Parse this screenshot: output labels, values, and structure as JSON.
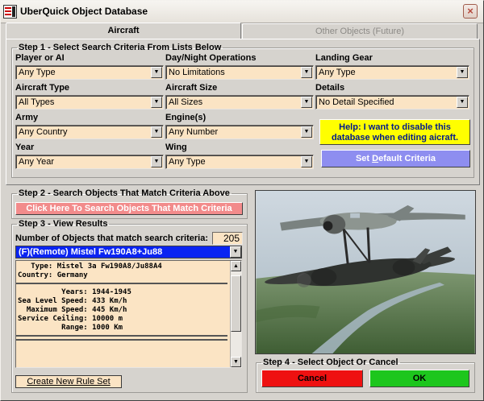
{
  "window": {
    "title": "UberQuick Object Database",
    "close_glyph": "×"
  },
  "tabs": [
    {
      "label": "Aircraft",
      "active": true
    },
    {
      "label": "Other Objects (Future)",
      "active": false
    }
  ],
  "step1": {
    "title": "Step 1 - Select Search Criteria From Lists Below",
    "fields": {
      "player": {
        "label": "Player or AI",
        "value": "Any Type"
      },
      "aircraft_type": {
        "label": "Aircraft Type",
        "value": "All Types"
      },
      "army": {
        "label": "Army",
        "value": "Any Country"
      },
      "year": {
        "label": "Year",
        "value": "Any Year"
      },
      "daynight": {
        "label": "Day/Night Operations",
        "value": "No Limitations"
      },
      "size": {
        "label": "Aircraft Size",
        "value": "All Sizes"
      },
      "engines": {
        "label": "Engine(s)",
        "value": "Any Number"
      },
      "wing": {
        "label": "Wing",
        "value": "Any Type"
      },
      "gear": {
        "label": "Landing Gear",
        "value": "Any Type"
      },
      "details": {
        "label": "Details",
        "value": "No Detail Specified"
      }
    },
    "help_button": {
      "line1": "Help: I want to disable this",
      "line2": "database when editing aicraft."
    },
    "default_button": {
      "pre": "Set ",
      "accel": "D",
      "post": "efault Criteria"
    }
  },
  "step2": {
    "title": "Step 2 - Search Objects That Match Criteria Above",
    "search_button": "Click Here To Search Objects That Match Criteria"
  },
  "step3": {
    "title": "Step 3 - View Results",
    "count_label": "Number of Objects that match search criteria:",
    "count_value": "205",
    "selected_object": "(F)(Remote) Mistel Fw190A8+Ju88",
    "details_top": "   Type: Mistel 3a Fw190A8/Ju88A4\nCountry: Germany",
    "details_specs": "          Years: 1944-1945\nSea Level Speed: 433 Km/h\n  Maximum Speed: 445 Km/h\nService Ceiling: 10000 m\n          Range: 1000 Km",
    "create_button": "Create New Rule Set"
  },
  "step4": {
    "title": "Step 4 - Select Object Or Cancel",
    "cancel_label": "Cancel",
    "ok_label": "OK"
  },
  "icons": {
    "app": "database-icon",
    "dropdown": "chevron-down-icon",
    "scroll_up": "scroll-up-icon",
    "scroll_down": "scroll-down-icon",
    "arrow_glyph": "▼",
    "up_glyph": "▲"
  },
  "colors": {
    "combo_bg": "#fbe4c4",
    "help_bg": "#ffff00",
    "help_text": "#001a8c",
    "default_bg": "#8e8ef0",
    "search_bg": "#f28b8b",
    "selected_bg": "#0a24f2",
    "cancel_bg": "#ee1111",
    "ok_bg": "#1dc61d"
  }
}
